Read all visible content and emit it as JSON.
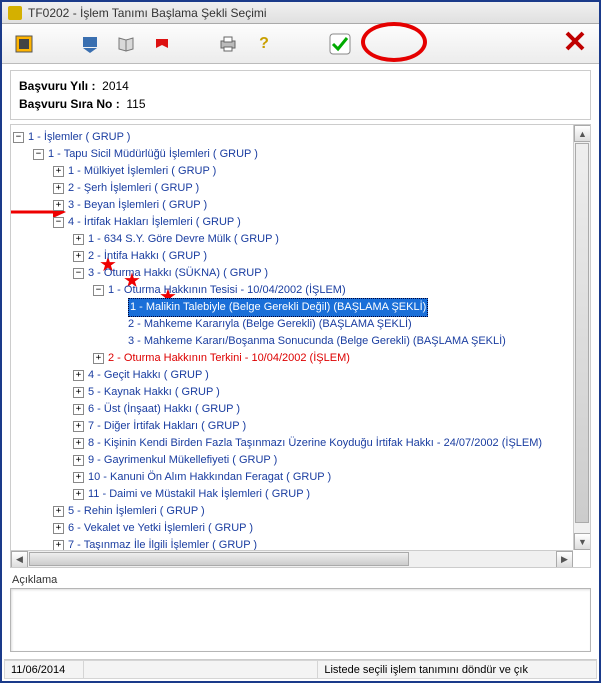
{
  "window": {
    "title": "TF0202 - İşlem Tanımı Başlama Şekli Seçimi"
  },
  "info": {
    "year_label": "Başvuru Yılı :",
    "year_value": "2014",
    "seq_label": "Başvuru Sıra No :",
    "seq_value": "115"
  },
  "tree": {
    "root": "1 - İşlemler ( GRUP )",
    "n1": "1 - Tapu Sicil Müdürlüğü İşlemleri ( GRUP )",
    "n1_1": "1 - Mülkiyet İşlemleri ( GRUP )",
    "n1_2": "2 - Şerh İşlemleri ( GRUP )",
    "n1_3": "3 - Beyan İşlemleri ( GRUP )",
    "n1_4": "4 - İrtifak Hakları İşlemleri ( GRUP )",
    "n1_4_1": "1 - 634 S.Y. Göre Devre Mülk ( GRUP )",
    "n1_4_2": "2 - İntifa Hakkı ( GRUP )",
    "n1_4_3": "3 - Oturma Hakkı (SÜKNA) ( GRUP )",
    "n1_4_3_1": "1 - Oturma Hakkının Tesisi - 10/04/2002 (İŞLEM)",
    "n1_4_3_1_1": "1 - Malikin Talebiyle (Belge Gerekli Değil) (BAŞLAMA ŞEKLİ)",
    "n1_4_3_1_2": "2 - Mahkeme Kararıyla (Belge Gerekli) (BAŞLAMA ŞEKLİ)",
    "n1_4_3_1_3": "3 - Mahkeme Kararı/Boşanma Sonucunda (Belge Gerekli) (BAŞLAMA ŞEKLİ)",
    "n1_4_3_2": "2 - Oturma Hakkının Terkini - 10/04/2002 (İŞLEM)",
    "n1_4_4": "4 - Geçit Hakkı ( GRUP )",
    "n1_4_5": "5 - Kaynak Hakkı ( GRUP )",
    "n1_4_6": "6 - Üst (İnşaat) Hakkı ( GRUP )",
    "n1_4_7": "7 - Diğer İrtifak Hakları ( GRUP )",
    "n1_4_8": "8 - Kişinin Kendi Birden Fazla Taşınmazı Üzerine Koyduğu İrtifak Hakkı - 24/07/2002 (İŞLEM)",
    "n1_4_9": "9 - Gayrimenkul Mükellefiyeti ( GRUP )",
    "n1_4_10": "10 - Kanuni Ön Alım Hakkından Feragat ( GRUP )",
    "n1_4_11": "11 - Daimi ve Müstakil Hak İşlemleri ( GRUP )",
    "n1_5": "5 - Rehin İşlemleri ( GRUP )",
    "n1_6": "6 - Vekalet ve Yetki İşlemleri ( GRUP )",
    "n1_7": "7 - Taşınmaz İle İlgili İşlemler ( GRUP )"
  },
  "desc": {
    "label": "Açıklama"
  },
  "status": {
    "date": "11/06/2014",
    "message": "Listede seçili işlem tanımını döndür ve çık"
  },
  "icons": {
    "plus": "+",
    "minus": "−"
  }
}
